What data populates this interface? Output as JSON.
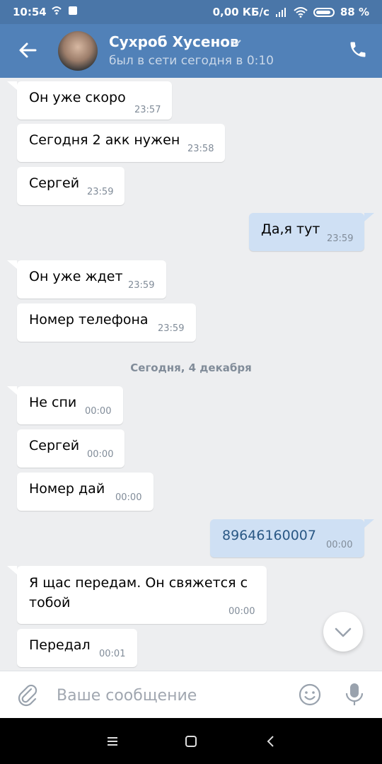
{
  "status_bar": {
    "time": "10:54",
    "network_speed": "0,00 КБ/с",
    "battery": "88 %"
  },
  "header": {
    "name": "Сухроб Хусенов",
    "last_seen": "был в сети сегодня в 0:10"
  },
  "messages": [
    {
      "text": "Он уже скоро",
      "time": "23:57",
      "direction": "in"
    },
    {
      "text": "Сегодня 2 акк нужен",
      "time": "23:58",
      "direction": "in"
    },
    {
      "text": "Сергей",
      "time": "23:59",
      "direction": "in"
    },
    {
      "text": "Да,я тут",
      "time": "23:59",
      "direction": "out"
    },
    {
      "text": "Он уже ждет",
      "time": "23:59",
      "direction": "in"
    },
    {
      "text": "Номер телефона",
      "time": "23:59",
      "direction": "in"
    },
    {
      "text": "Не спи",
      "time": "00:00",
      "direction": "in"
    },
    {
      "text": "Сергей",
      "time": "00:00",
      "direction": "in"
    },
    {
      "text": "Номер дай",
      "time": "00:00",
      "direction": "in"
    },
    {
      "text": "89646160007",
      "time": "00:00",
      "direction": "out"
    },
    {
      "text": "Я щас передам.  Он свяжется с тобой",
      "time": "00:00",
      "direction": "in"
    },
    {
      "text": "Передал",
      "time": "00:01",
      "direction": "in"
    }
  ],
  "date_separator": "Сегодня, 4 декабря",
  "composer": {
    "placeholder": "Ваше сообщение"
  },
  "colors": {
    "header": "#5181b8",
    "status_bar": "#4a76a8",
    "outgoing_bubble": "#cfe0f4",
    "background": "#edeef0",
    "link": "#2a5885"
  },
  "icons": {
    "back": "arrow-left-icon",
    "phone": "phone-icon",
    "attach": "paperclip-icon",
    "emoji": "smile-icon",
    "mic": "microphone-icon",
    "scroll": "chevron-down-icon"
  }
}
